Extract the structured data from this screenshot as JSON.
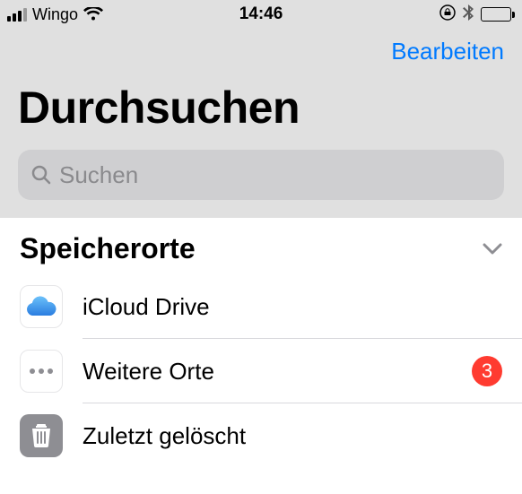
{
  "status": {
    "carrier": "Wingo",
    "time": "14:46"
  },
  "nav": {
    "edit_label": "Bearbeiten",
    "title": "Durchsuchen"
  },
  "search": {
    "placeholder": "Suchen"
  },
  "locations": {
    "heading": "Speicherorte",
    "items": [
      {
        "label": "iCloud Drive"
      },
      {
        "label": "Weitere Orte",
        "badge": "3"
      },
      {
        "label": "Zuletzt gelöscht"
      }
    ]
  }
}
